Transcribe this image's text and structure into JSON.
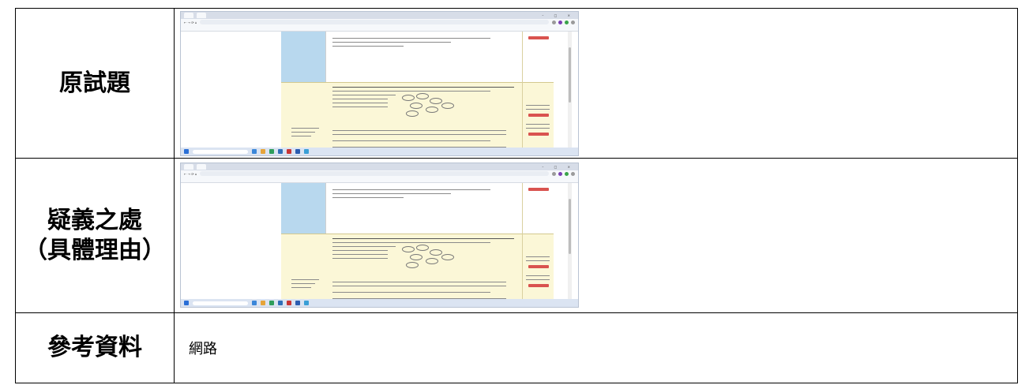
{
  "rows": [
    {
      "label": "原試題"
    },
    {
      "label_line1": "疑義之處",
      "label_line2": "（具體理由）"
    },
    {
      "label": "參考資料",
      "content": "網路"
    }
  ],
  "colors": {
    "border": "#000000",
    "sidebar_blue": "#b8d8ee",
    "highlight_yellow": "#fbf7d7",
    "button_red": "#d9534f"
  }
}
